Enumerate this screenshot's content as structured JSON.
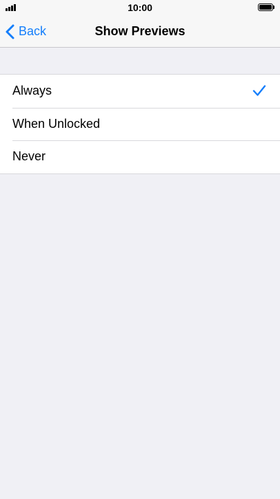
{
  "status_bar": {
    "time": "10:00",
    "signal_icon": "cellular-signal-icon",
    "battery_icon": "battery-icon",
    "battery_level": 1.0
  },
  "nav": {
    "back_label": "Back",
    "title": "Show Previews"
  },
  "options": [
    {
      "label": "Always",
      "selected": true
    },
    {
      "label": "When Unlocked",
      "selected": false
    },
    {
      "label": "Never",
      "selected": false
    }
  ],
  "colors": {
    "accent": "#147efb",
    "background": "#f0f0f5",
    "bar_background": "#f7f7f7",
    "separator": "#d8d8dc"
  }
}
